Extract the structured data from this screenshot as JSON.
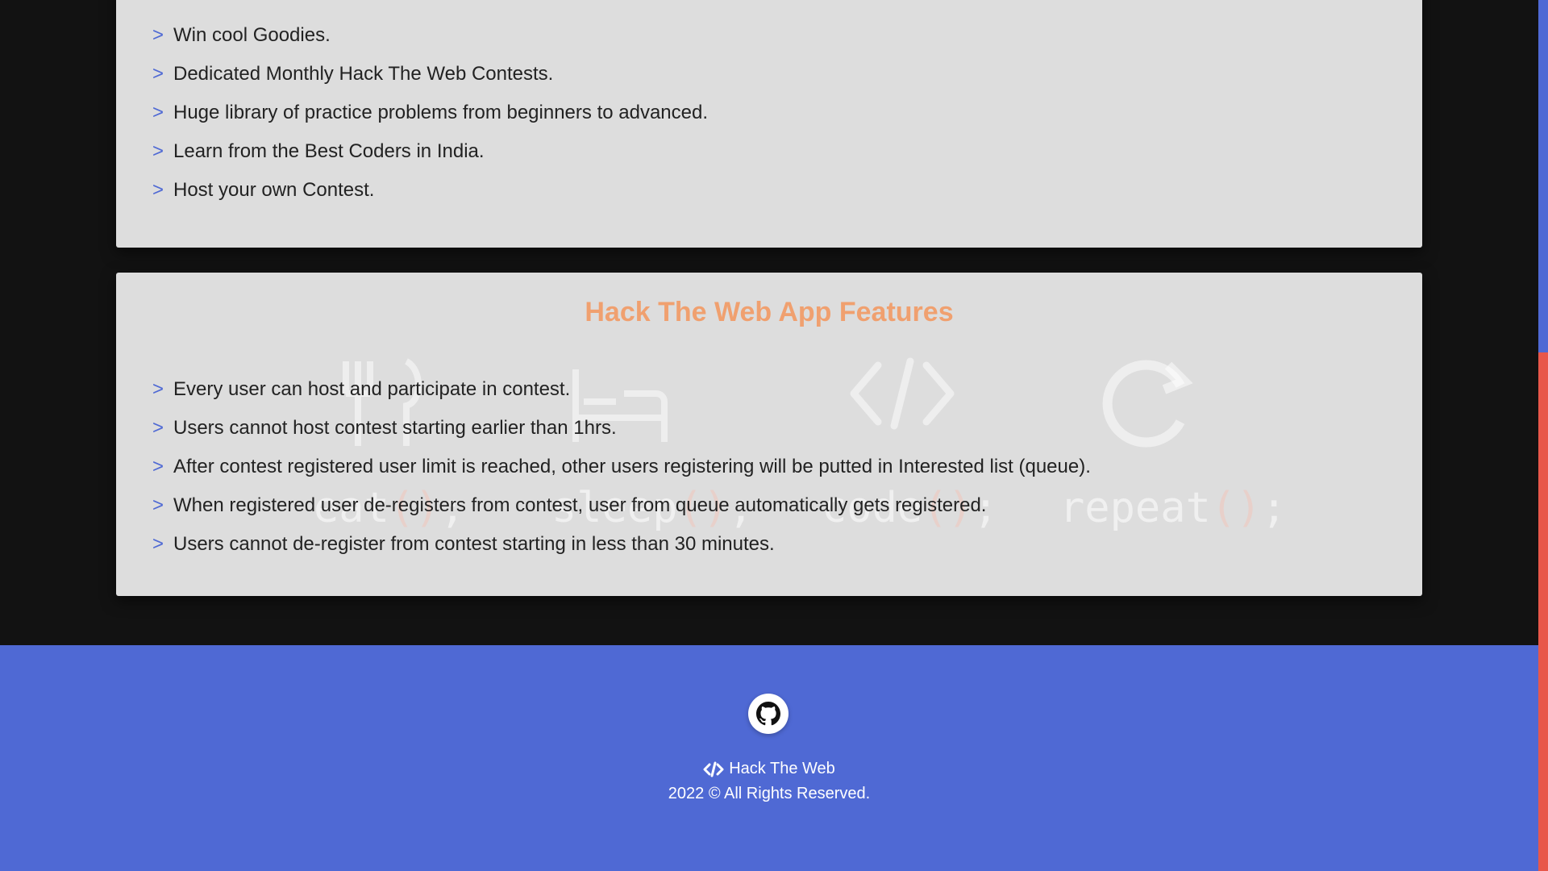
{
  "card_general": {
    "items": [
      "Win cool Goodies.",
      "Dedicated Monthly Hack The Web Contests.",
      "Huge library of practice problems from beginners to advanced.",
      "Learn from the Best Coders in India.",
      "Host your own Contest."
    ]
  },
  "card_app": {
    "title": "Hack The Web App Features",
    "items": [
      "Every user can host and participate in contest.",
      "Users cannot host contest starting earlier than 1hrs.",
      "After contest registered user limit is reached, other users registering will be putted in Interested list (queue).",
      "When registered user de-registers from contest, user from queue automatically gets registered.",
      "Users cannot de-register from contest starting in less than 30 minutes."
    ],
    "watermark": {
      "words": [
        "eat",
        "sleep",
        "code",
        "repeat"
      ],
      "suffix": "();",
      "open_paren": "(",
      "close_paren": ")",
      "semicolon": ";"
    }
  },
  "bullet_glyph": ">",
  "footer": {
    "brand": "Hack The Web",
    "copyright": "2022 © All Rights Reserved.",
    "icons": {
      "social": "github-icon",
      "brand": "code-icon"
    }
  },
  "colors": {
    "accent": "#4f69d4",
    "title": "#f0a06f",
    "card_bg": "#dddddd",
    "page_bg": "#121212",
    "scroll_thumb": "#e8574a"
  }
}
